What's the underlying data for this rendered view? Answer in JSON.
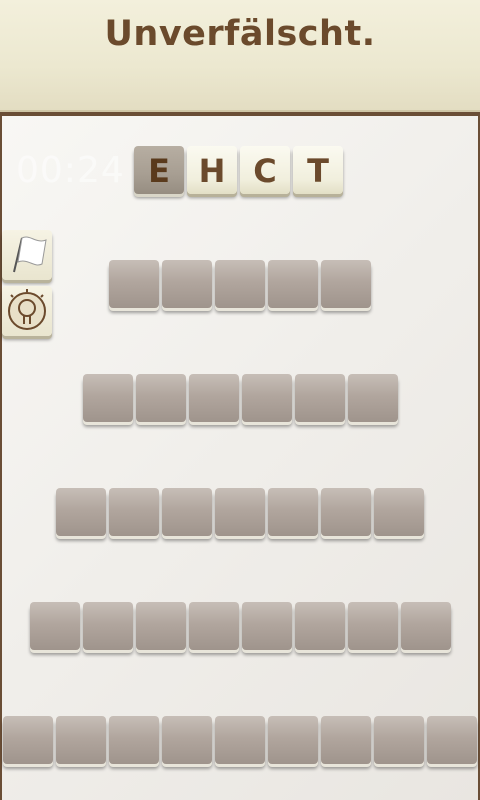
{
  "header": {
    "title": "Unverfälscht."
  },
  "timer": {
    "value": "00:24"
  },
  "letters": [
    {
      "char": "E",
      "used": true
    },
    {
      "char": "H",
      "used": false
    },
    {
      "char": "C",
      "used": false
    },
    {
      "char": "T",
      "used": false
    }
  ],
  "side_buttons": [
    {
      "icon": "flag-icon"
    },
    {
      "icon": "lightbulb-hint-icon"
    }
  ],
  "word_rows": [
    {
      "length": 5
    },
    {
      "length": 6
    },
    {
      "length": 7
    },
    {
      "length": 8
    },
    {
      "length": 9
    }
  ]
}
